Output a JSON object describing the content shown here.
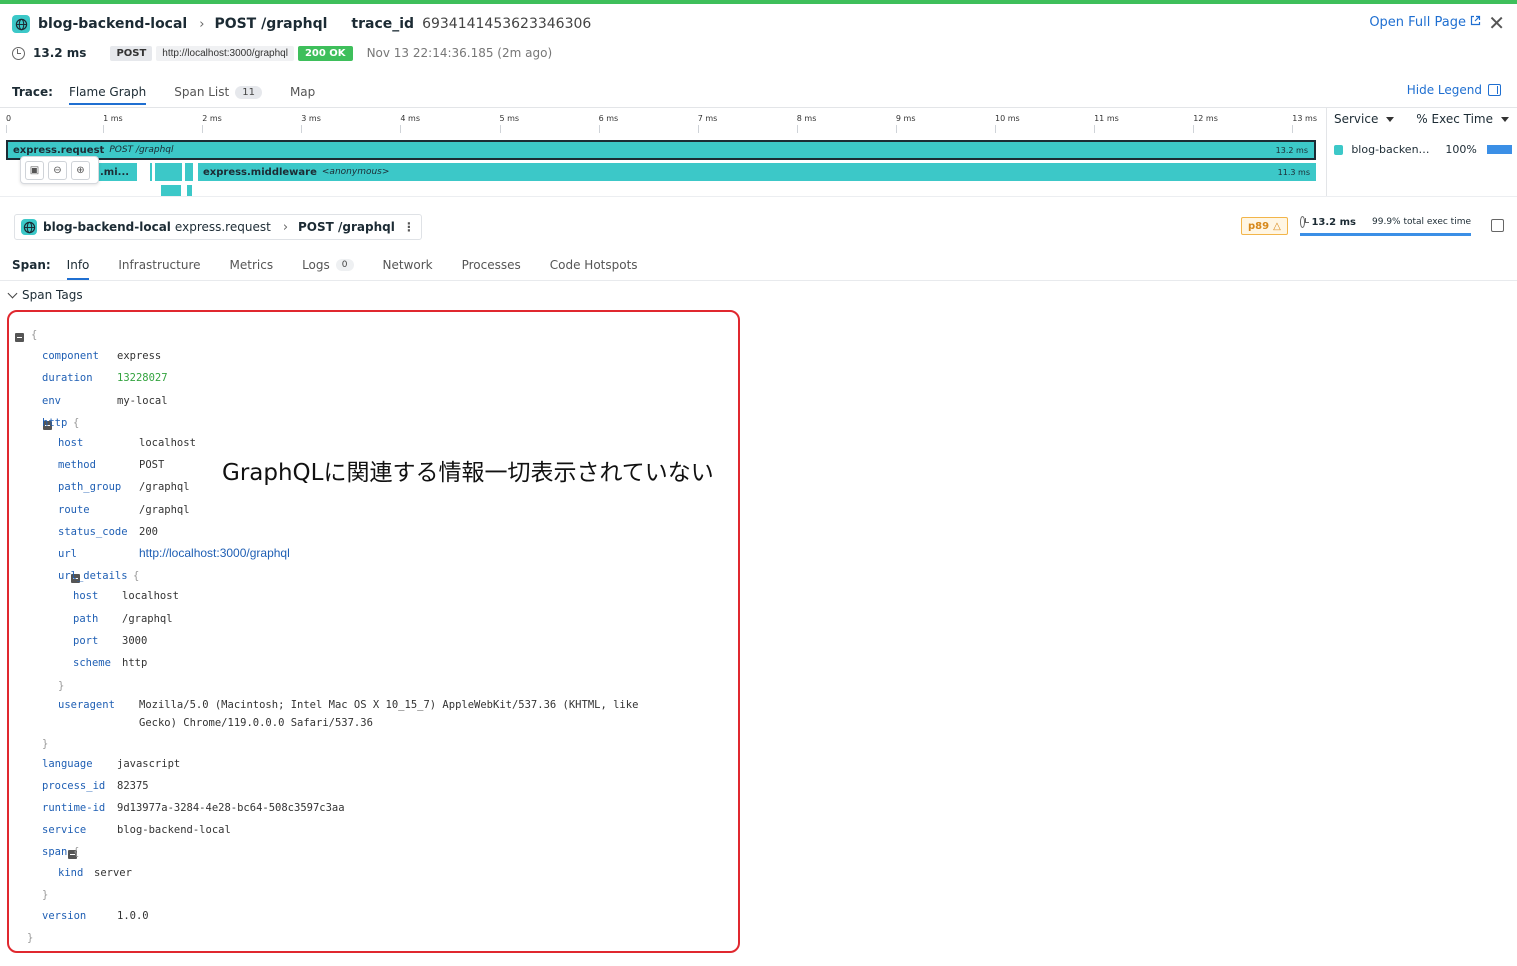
{
  "header": {
    "service": "blog-backend-local",
    "route": "POST /graphql",
    "trace_label": "trace_id",
    "trace_id": "6934141453623346306",
    "open_full_page": "Open Full Page",
    "duration": "13.2 ms",
    "method": "POST",
    "url": "http://localhost:3000/graphql",
    "status": "200 OK",
    "timestamp": "Nov 13 22:14:36.185 (2m ago)"
  },
  "trace_tabs": {
    "label": "Trace:",
    "flame_graph": "Flame Graph",
    "span_list": "Span List",
    "span_count": "11",
    "map": "Map",
    "hide_legend": "Hide Legend"
  },
  "ruler": [
    "0",
    "1 ms",
    "2 ms",
    "3 ms",
    "4 ms",
    "5 ms",
    "6 ms",
    "7 ms",
    "8 ms",
    "9 ms",
    "10 ms",
    "11 ms",
    "12 ms",
    "13 ms"
  ],
  "legend": {
    "service_col": "Service",
    "exec_col": "% Exec Time",
    "row_service": "blog-backend-local",
    "row_pct": "100%"
  },
  "flame": {
    "root_name": "express.request",
    "root_resource": "POST /graphql",
    "root_dur": "13.2 ms",
    "child_short": ".mi...",
    "mw_name": "express.middleware",
    "mw_resource": "<anonymous>",
    "mw_dur": "11.3 ms"
  },
  "span_header": {
    "service": "blog-backend-local",
    "operation": "express.request",
    "resource": "POST /graphql",
    "p89": "p89",
    "duration": "13.2 ms",
    "pct_exec": "99.9% total exec time"
  },
  "span_tabs": {
    "label": "Span:",
    "info": "Info",
    "infrastructure": "Infrastructure",
    "metrics": "Metrics",
    "logs": "Logs",
    "logs_count": "0",
    "network": "Network",
    "processes": "Processes",
    "code_hotspots": "Code Hotspots"
  },
  "span_tags_title": "Span Tags",
  "tags": {
    "component": "express",
    "duration": "13228027",
    "env": "my-local",
    "http_host": "localhost",
    "http_method": "POST",
    "http_path_group": "/graphql",
    "http_route": "/graphql",
    "http_status_code": "200",
    "http_url": "http://localhost:3000/graphql",
    "ud_host": "localhost",
    "ud_path": "/graphql",
    "ud_port": "3000",
    "ud_scheme": "http",
    "useragent_1": "Mozilla/5.0 (Macintosh; Intel Mac OS X 10_15_7) AppleWebKit/537.36 (KHTML, like",
    "useragent_2": "Gecko) Chrome/119.0.0.0 Safari/537.36",
    "language": "javascript",
    "process_id": "82375",
    "runtime_id": "9d13977a-3284-4e28-bc64-508c3597c3aa",
    "service": "blog-backend-local",
    "span_kind": "server",
    "version": "1.0.0"
  },
  "tag_keys": {
    "component": "component",
    "duration": "duration",
    "env": "env",
    "http": "http",
    "host": "host",
    "method": "method",
    "path_group": "path_group",
    "route": "route",
    "status_code": "status_code",
    "url": "url",
    "url_details": "url_details",
    "path": "path",
    "port": "port",
    "scheme": "scheme",
    "useragent": "useragent",
    "language": "language",
    "process_id": "process_id",
    "runtime_id": "runtime-id",
    "service": "service",
    "span": "span",
    "kind": "kind",
    "version": "version"
  },
  "annotation": "GraphQLに関連する情報一切表示されていない",
  "colors": {
    "accent": "#1f6fd1",
    "service": "#3cc8c8",
    "ok": "#3ebf5b",
    "highlight": "#e0282f"
  },
  "icons": [
    "globe-icon",
    "clock-icon",
    "external-link-icon",
    "close-icon",
    "legend-toggle-icon",
    "zoom-in-icon",
    "zoom-out-icon",
    "fit-icon",
    "warning-icon",
    "collapse-icon",
    "chevron-down-icon"
  ]
}
